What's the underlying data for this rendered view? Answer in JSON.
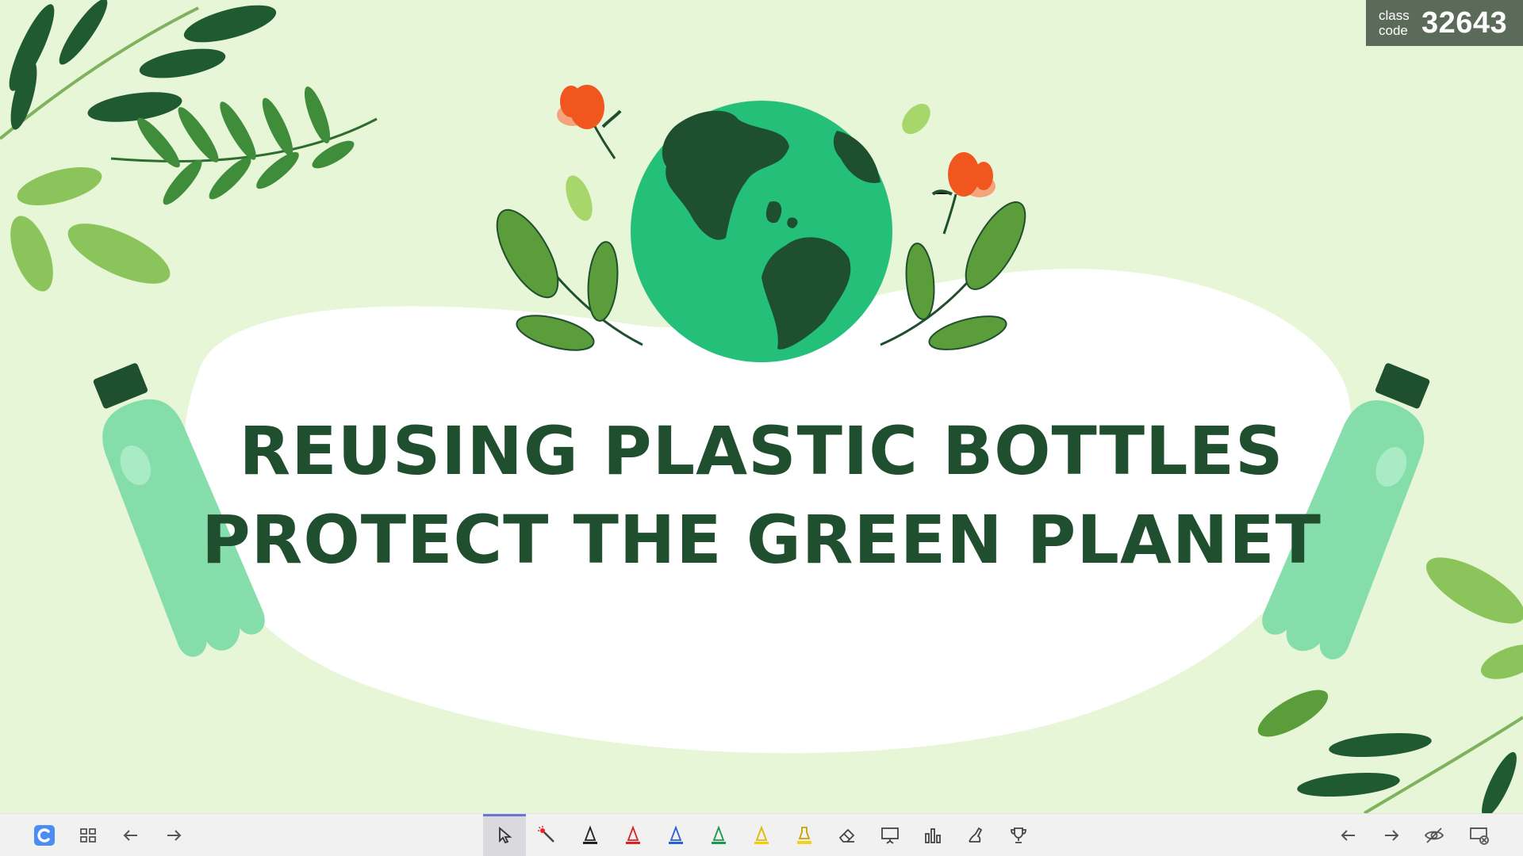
{
  "slide": {
    "title_line_1": "REUSING PLASTIC BOTTLES",
    "title_line_2": "PROTECT THE GREEN PLANET"
  },
  "class_code": {
    "label_line_1": "class",
    "label_line_2": "code",
    "value": "32643"
  },
  "colors": {
    "background": "#e8f6d8",
    "title_text": "#1f4f2e",
    "globe_ocean": "#24c07a",
    "globe_land": "#1e4f2f",
    "bottle": "#7fdca8",
    "flower": "#f0561e",
    "class_code_bg": "#5b6b59",
    "active_tool_accent": "#6c74d8"
  },
  "toolbar": {
    "left": [
      "app-logo-icon",
      "grid-view-icon",
      "arrow-left-icon",
      "arrow-right-icon"
    ],
    "center": [
      "pointer-icon",
      "laser-pointer-icon",
      "pen-black-icon",
      "pen-red-icon",
      "pen-blue-icon",
      "pen-green-icon",
      "pen-yellow-icon",
      "highlighter-icon",
      "eraser-icon",
      "whiteboard-icon",
      "bar-chart-icon",
      "hand-raise-icon",
      "trophy-icon"
    ],
    "right": [
      "previous-slide-icon",
      "next-slide-icon",
      "hide-icon",
      "end-presentation-icon"
    ],
    "active_tool": "pointer-icon"
  }
}
